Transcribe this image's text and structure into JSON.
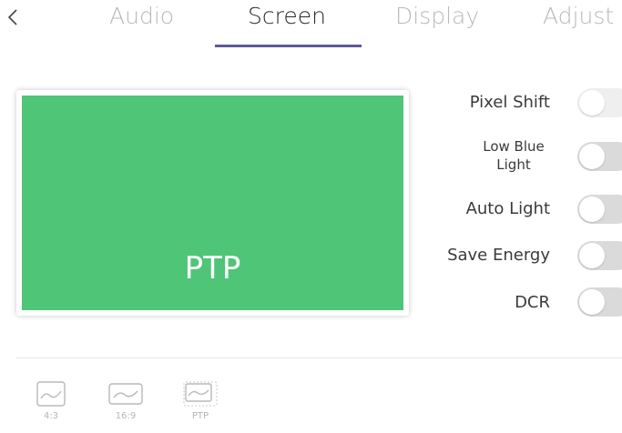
{
  "tabs": [
    {
      "label": "Audio",
      "active": false
    },
    {
      "label": "Screen",
      "active": true
    },
    {
      "label": "Display",
      "active": false
    },
    {
      "label": "Adjust",
      "active": false
    }
  ],
  "accent_color": "#5c5a98",
  "preview": {
    "label": "PTP",
    "color": "#4fc577"
  },
  "toggles": [
    {
      "label": "Pixel Shift",
      "on": false
    },
    {
      "label": "Low Blue Light",
      "on": false
    },
    {
      "label": "Auto Light",
      "on": false
    },
    {
      "label": "Save Energy",
      "on": false
    },
    {
      "label": "DCR",
      "on": false
    }
  ],
  "ratios": [
    {
      "label": "4:3"
    },
    {
      "label": "16:9"
    },
    {
      "label": "PTP"
    }
  ]
}
